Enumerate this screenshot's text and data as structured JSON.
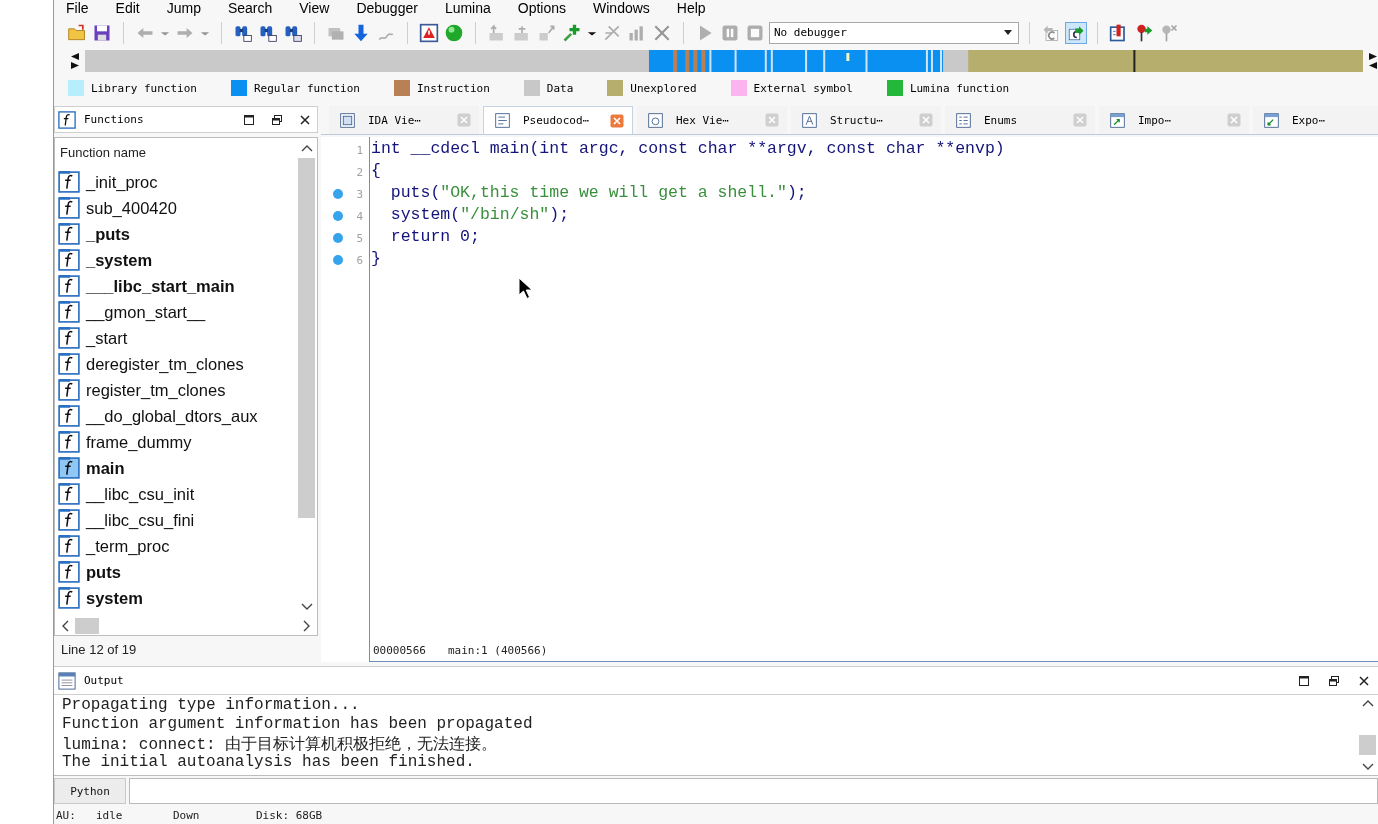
{
  "menu": [
    "File",
    "Edit",
    "Jump",
    "Search",
    "View",
    "Debugger",
    "Lumina",
    "Options",
    "Windows",
    "Help"
  ],
  "toolbar": {
    "buttons": [
      {
        "disabled": false,
        "pressed": false
      },
      {
        "disabled": false,
        "pressed": false
      },
      {
        "disabled": true,
        "pressed": false
      },
      {
        "disabled": true,
        "pressed": false
      },
      {
        "disabled": true,
        "pressed": false
      },
      {
        "disabled": true,
        "pressed": false
      },
      {
        "disabled": false,
        "pressed": false
      },
      {
        "disabled": false,
        "pressed": false
      },
      {
        "disabled": false,
        "pressed": false
      },
      {
        "disabled": true,
        "pressed": false
      },
      {
        "disabled": false,
        "pressed": false
      },
      {
        "disabled": true,
        "pressed": false
      },
      {
        "disabled": false,
        "pressed": false
      },
      {
        "disabled": false,
        "pressed": false
      },
      {
        "disabled": true,
        "pressed": false
      },
      {
        "disabled": true,
        "pressed": false
      },
      {
        "disabled": true,
        "pressed": false
      },
      {
        "disabled": false,
        "pressed": false
      },
      {
        "disabled": false,
        "pressed": false
      },
      {
        "disabled": true,
        "pressed": false
      },
      {
        "disabled": true,
        "pressed": false
      },
      {
        "disabled": true,
        "pressed": false
      },
      {
        "disabled": true,
        "pressed": false
      },
      {
        "disabled": true,
        "pressed": false
      },
      {
        "disabled": true,
        "pressed": false
      },
      {
        "disabled": true,
        "pressed": false
      },
      {
        "disabled": false,
        "pressed": true
      },
      {
        "disabled": false,
        "pressed": false
      },
      {
        "disabled": false,
        "pressed": false
      },
      {
        "disabled": true,
        "pressed": false
      }
    ],
    "debugger": "No debugger"
  },
  "legend": [
    {
      "label": "Library function",
      "color": "#b7eefc"
    },
    {
      "label": "Regular function",
      "color": "#0a90f0"
    },
    {
      "label": "Instruction",
      "color": "#b97f55"
    },
    {
      "label": "Data",
      "color": "#c8c8c8"
    },
    {
      "label": "Unexplored",
      "color": "#b5ae6c"
    },
    {
      "label": "External symbol",
      "color": "#fcb4f0"
    },
    {
      "label": "Lumina function",
      "color": "#22b83a"
    }
  ],
  "functions_panel": {
    "title": "Functions",
    "column": "Function name",
    "items": [
      {
        "name": "_init_proc",
        "bold": false,
        "selected": false
      },
      {
        "name": "sub_400420",
        "bold": false,
        "selected": false
      },
      {
        "name": "_puts",
        "bold": true,
        "selected": false
      },
      {
        "name": "_system",
        "bold": true,
        "selected": false
      },
      {
        "name": "___libc_start_main",
        "bold": true,
        "selected": false
      },
      {
        "name": "__gmon_start__",
        "bold": false,
        "selected": false
      },
      {
        "name": "_start",
        "bold": false,
        "selected": false
      },
      {
        "name": "deregister_tm_clones",
        "bold": false,
        "selected": false
      },
      {
        "name": "register_tm_clones",
        "bold": false,
        "selected": false
      },
      {
        "name": "__do_global_dtors_aux",
        "bold": false,
        "selected": false
      },
      {
        "name": "frame_dummy",
        "bold": false,
        "selected": false
      },
      {
        "name": "main",
        "bold": true,
        "selected": true
      },
      {
        "name": "__libc_csu_init",
        "bold": false,
        "selected": false
      },
      {
        "name": "__libc_csu_fini",
        "bold": false,
        "selected": false
      },
      {
        "name": "_term_proc",
        "bold": false,
        "selected": false
      },
      {
        "name": "puts",
        "bold": true,
        "selected": false
      },
      {
        "name": "system",
        "bold": true,
        "selected": false
      }
    ],
    "status": "Line 12 of 19"
  },
  "tabs": [
    {
      "label": "IDA Vie⋯",
      "selected": false
    },
    {
      "label": "Pseudocod⋯",
      "selected": true
    },
    {
      "label": "Hex Vie⋯",
      "selected": false
    },
    {
      "label": "Structu⋯",
      "selected": false
    },
    {
      "label": "Enums",
      "selected": false
    },
    {
      "label": "Impo⋯",
      "selected": false
    },
    {
      "label": "Expo⋯",
      "selected": false
    }
  ],
  "pseudocode": {
    "lines": [
      {
        "number": "1",
        "marker": false,
        "tokens": [
          {
            "text": "int __cdecl main(int argc, const char **argv, const char **envp)",
            "kind": "code"
          }
        ]
      },
      {
        "number": "2",
        "marker": false,
        "tokens": [
          {
            "text": "{",
            "kind": "code"
          }
        ]
      },
      {
        "number": "3",
        "marker": true,
        "tokens": [
          {
            "text": "  puts(",
            "kind": "code"
          },
          {
            "text": "\"OK,this time we will get a shell.\"",
            "kind": "string"
          },
          {
            "text": ");",
            "kind": "code"
          }
        ]
      },
      {
        "number": "4",
        "marker": true,
        "tokens": [
          {
            "text": "  system(",
            "kind": "code"
          },
          {
            "text": "\"/bin/sh\"",
            "kind": "string"
          },
          {
            "text": ");",
            "kind": "code"
          }
        ]
      },
      {
        "number": "5",
        "marker": true,
        "tokens": [
          {
            "text": "  return 0;",
            "kind": "code"
          }
        ]
      },
      {
        "number": "6",
        "marker": true,
        "tokens": [
          {
            "text": "}",
            "kind": "code"
          }
        ]
      }
    ],
    "status": [
      "00000566",
      "main:1 (400566)"
    ]
  },
  "output": {
    "title": "Output",
    "lines": [
      "Propagating type information...",
      "Function argument information has been propagated",
      "lumina: connect: 由于目标计算机积极拒绝，无法连接。",
      "The initial autoanalysis has been finished."
    ]
  },
  "python": {
    "button": "Python"
  },
  "status_bar": [
    "AU:",
    "idle",
    "Down",
    "Disk: 68GB"
  ]
}
